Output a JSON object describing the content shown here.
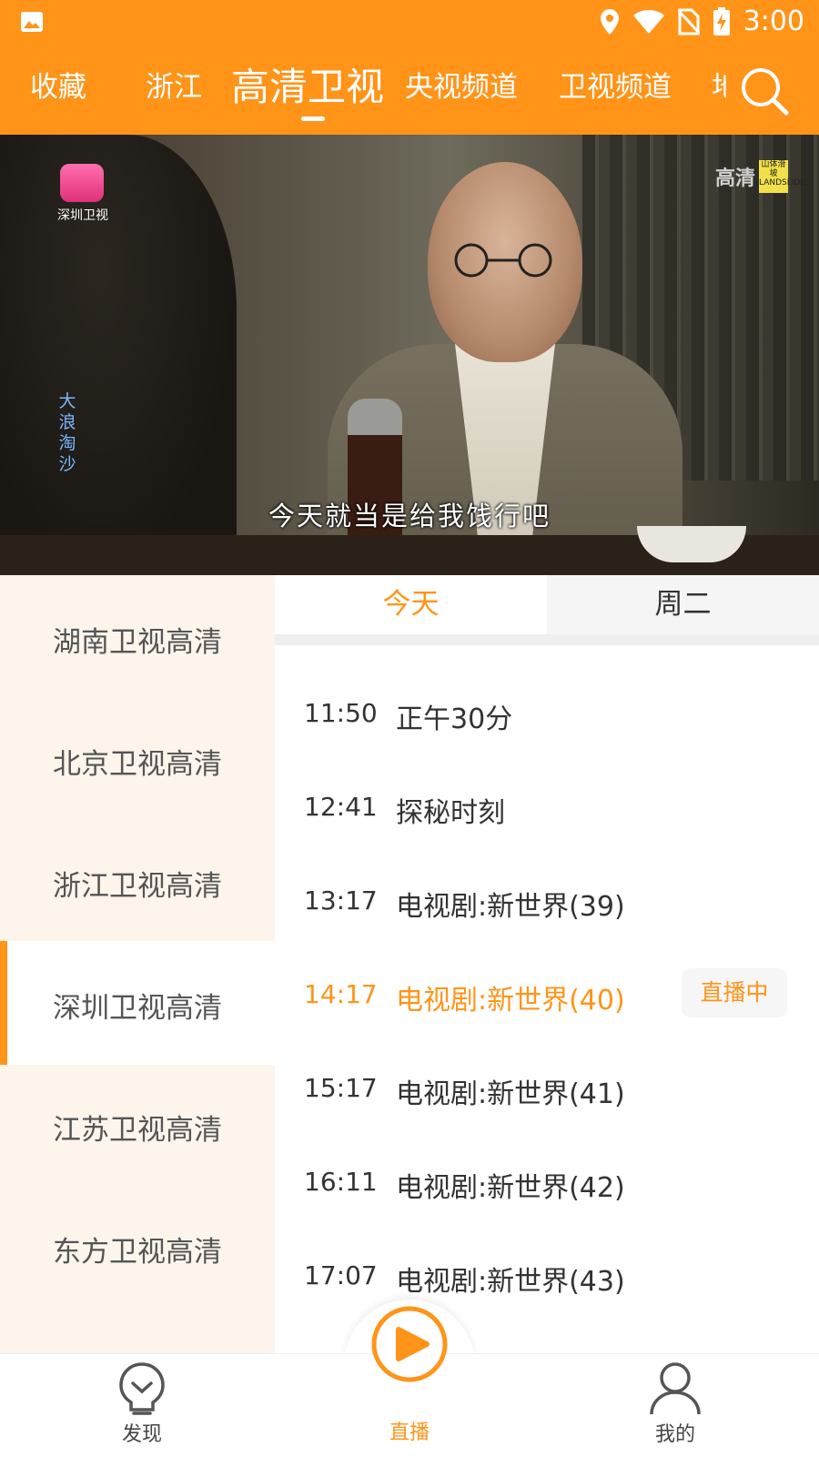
{
  "status_bar": {
    "time": "3:00"
  },
  "top_tabs": [
    {
      "label": "收藏"
    },
    {
      "label": "浙江"
    },
    {
      "label": "高清卫视",
      "active": true
    },
    {
      "label": "央视频道"
    },
    {
      "label": "卫视频道"
    },
    {
      "label": "地"
    }
  ],
  "video": {
    "channel_logo_text": "深圳卫视",
    "hd_badge": "高清",
    "sponsor_badge": "山体滑坡 LANDSLIDE",
    "side_title": "大浪淘沙",
    "subtitle": "今天就当是给我饯行吧"
  },
  "channels": [
    {
      "label": "湖南卫视高清"
    },
    {
      "label": "北京卫视高清"
    },
    {
      "label": "浙江卫视高清"
    },
    {
      "label": "深圳卫视高清",
      "active": true
    },
    {
      "label": "江苏卫视高清"
    },
    {
      "label": "东方卫视高清"
    }
  ],
  "day_tabs": {
    "today": "今天",
    "next": "周二"
  },
  "programs": [
    {
      "time": "11:50",
      "name": "正午30分"
    },
    {
      "time": "12:41",
      "name": "探秘时刻"
    },
    {
      "time": "13:17",
      "name": "电视剧:新世界(39)"
    },
    {
      "time": "14:17",
      "name": "电视剧:新世界(40)",
      "live": true
    },
    {
      "time": "15:17",
      "name": "电视剧:新世界(41)"
    },
    {
      "time": "16:11",
      "name": "电视剧:新世界(42)"
    },
    {
      "time": "17:07",
      "name": "电视剧:新世界(43)"
    }
  ],
  "live_badge": "直播中",
  "bottom_nav": {
    "discover": "发现",
    "live": "直播",
    "mine": "我的"
  },
  "colors": {
    "accent": "#FF9419",
    "channel_bg": "#FDF4EC"
  }
}
